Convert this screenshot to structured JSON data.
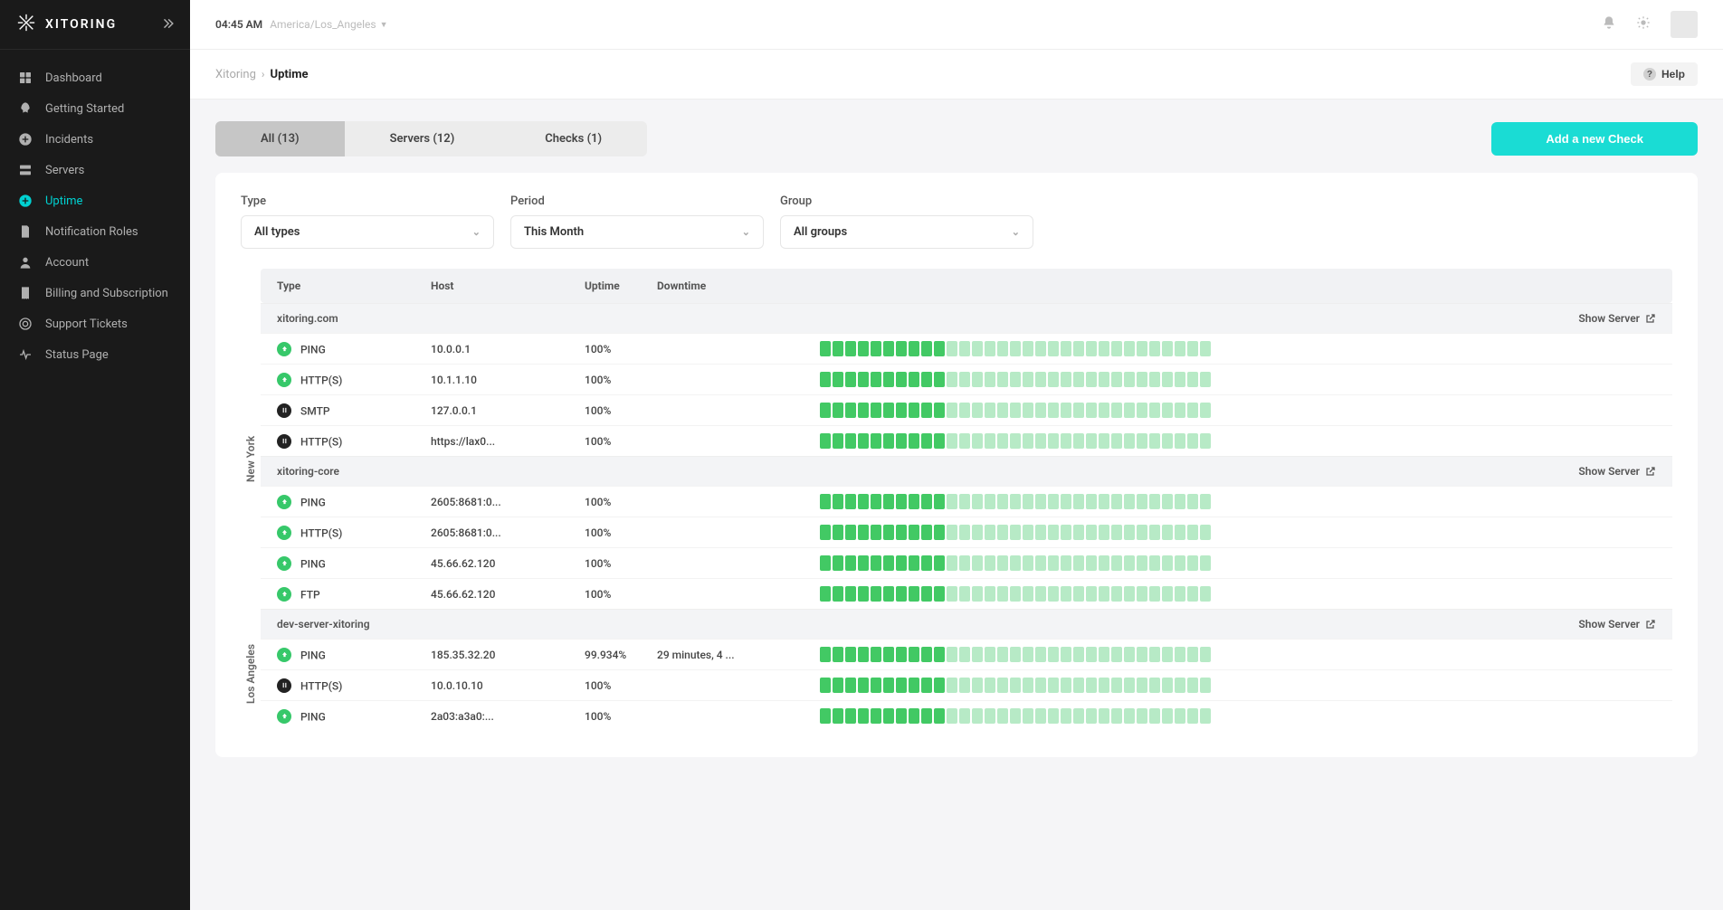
{
  "brand": "XITORING",
  "topbar": {
    "time": "04:45 AM",
    "timezone": "America/Los_Angeles"
  },
  "sidebar": {
    "items": [
      {
        "label": "Dashboard",
        "icon": "grid"
      },
      {
        "label": "Getting Started",
        "icon": "rocket"
      },
      {
        "label": "Incidents",
        "icon": "plus-circle"
      },
      {
        "label": "Servers",
        "icon": "server"
      },
      {
        "label": "Uptime",
        "icon": "plus-circle",
        "active": true
      },
      {
        "label": "Notification Roles",
        "icon": "bell-doc"
      },
      {
        "label": "Account",
        "icon": "user"
      },
      {
        "label": "Billing and Subscription",
        "icon": "receipt"
      },
      {
        "label": "Support Tickets",
        "icon": "life-ring"
      },
      {
        "label": "Status Page",
        "icon": "heartbeat"
      }
    ]
  },
  "breadcrumb": {
    "root": "Xitoring",
    "current": "Uptime",
    "help": "Help"
  },
  "tabs": {
    "items": [
      {
        "label": "All (13)",
        "active": true
      },
      {
        "label": "Servers (12)"
      },
      {
        "label": "Checks (1)"
      }
    ],
    "add_button": "Add a new Check"
  },
  "filters": {
    "type": {
      "label": "Type",
      "value": "All types"
    },
    "period": {
      "label": "Period",
      "value": "This Month"
    },
    "group": {
      "label": "Group",
      "value": "All groups"
    }
  },
  "columns": {
    "type": "Type",
    "host": "Host",
    "uptime": "Uptime",
    "downtime": "Downtime"
  },
  "show_server_label": "Show Server",
  "regions": [
    {
      "name": "New York",
      "groups": [
        {
          "name": "xitoring.com",
          "rows": [
            {
              "status": "up",
              "type": "PING",
              "host": "10.0.0.1",
              "uptime": "100%",
              "downtime": "",
              "filled": 10
            },
            {
              "status": "up",
              "type": "HTTP(S)",
              "host": "10.1.1.10",
              "uptime": "100%",
              "downtime": "",
              "filled": 10
            },
            {
              "status": "paused",
              "type": "SMTP",
              "host": "127.0.0.1",
              "uptime": "100%",
              "downtime": "",
              "filled": 10
            },
            {
              "status": "paused",
              "type": "HTTP(S)",
              "host": "https://lax0...",
              "uptime": "100%",
              "downtime": "",
              "filled": 10
            }
          ]
        },
        {
          "name": "xitoring-core",
          "rows": [
            {
              "status": "up",
              "type": "PING",
              "host": "2605:8681:0...",
              "uptime": "100%",
              "downtime": "",
              "filled": 10
            },
            {
              "status": "up",
              "type": "HTTP(S)",
              "host": "2605:8681:0...",
              "uptime": "100%",
              "downtime": "",
              "filled": 10
            },
            {
              "status": "up",
              "type": "PING",
              "host": "45.66.62.120",
              "uptime": "100%",
              "downtime": "",
              "filled": 10
            },
            {
              "status": "up",
              "type": "FTP",
              "host": "45.66.62.120",
              "uptime": "100%",
              "downtime": "",
              "filled": 10
            }
          ]
        }
      ]
    },
    {
      "name": "Los Angeles",
      "groups": [
        {
          "name": "dev-server-xitoring",
          "rows": [
            {
              "status": "up",
              "type": "PING",
              "host": "185.35.32.20",
              "uptime": "99.934%",
              "downtime": "29 minutes, 4 ...",
              "filled": 10
            },
            {
              "status": "paused",
              "type": "HTTP(S)",
              "host": "10.0.10.10",
              "uptime": "100%",
              "downtime": "",
              "filled": 10
            },
            {
              "status": "up",
              "type": "PING",
              "host": "2a03:a3a0:...",
              "uptime": "100%",
              "downtime": "",
              "filled": 10
            }
          ]
        }
      ]
    }
  ],
  "bar_total": 31
}
